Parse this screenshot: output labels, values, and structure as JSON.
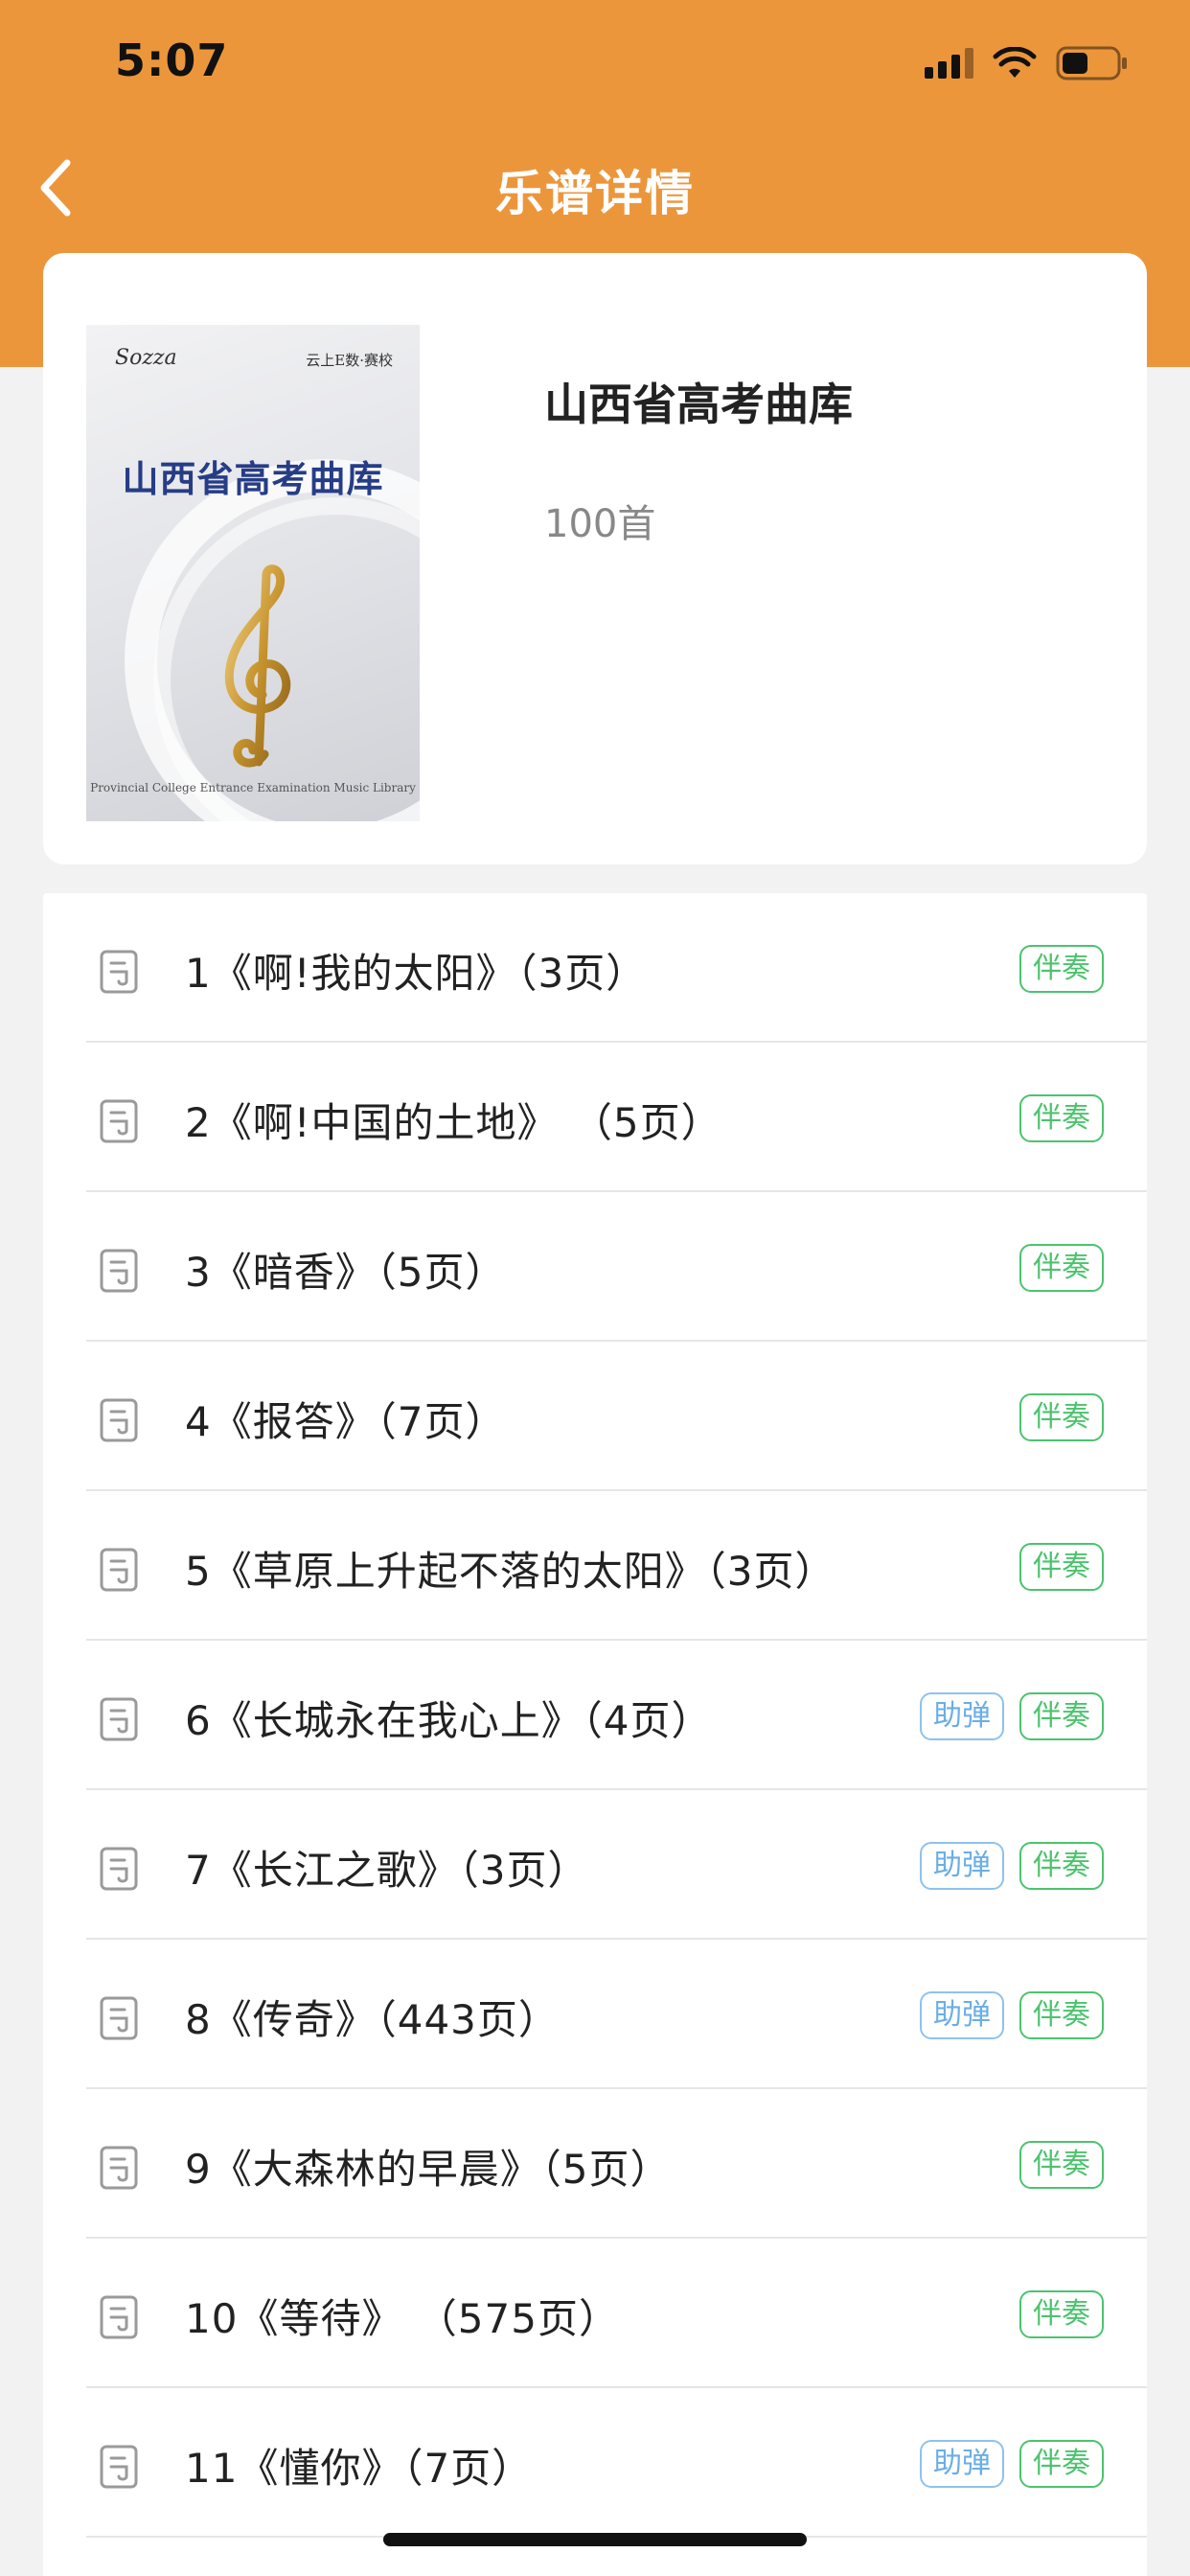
{
  "status_bar": {
    "time": "5:07"
  },
  "nav": {
    "title": "乐谱详情"
  },
  "book": {
    "title": "山西省高考曲库",
    "count": "100首",
    "cover": {
      "brand": "Sozza",
      "sub": "云上E数·赛校",
      "title": "山西省高考曲库",
      "footer": "Provincial College Entrance Examination Music Library"
    }
  },
  "songs": [
    {
      "title": "1《啊!我的太阳》（3页）",
      "tags": [
        "伴奏"
      ]
    },
    {
      "title": "2《啊!中国的土地》 （5页）",
      "tags": [
        "伴奏"
      ]
    },
    {
      "title": "3《暗香》（5页）",
      "tags": [
        "伴奏"
      ]
    },
    {
      "title": "4《报答》（7页）",
      "tags": [
        "伴奏"
      ]
    },
    {
      "title": "5《草原上升起不落的太阳》（3页）",
      "tags": [
        "伴奏"
      ]
    },
    {
      "title": "6《长城永在我心上》（4页）",
      "tags": [
        "助弹",
        "伴奏"
      ]
    },
    {
      "title": "7《长江之歌》（3页）",
      "tags": [
        "助弹",
        "伴奏"
      ]
    },
    {
      "title": "8《传奇》（443页）",
      "tags": [
        "助弹",
        "伴奏"
      ]
    },
    {
      "title": "9《大森林的早晨》（5页）",
      "tags": [
        "伴奏"
      ]
    },
    {
      "title": "10《等待》 （575页）",
      "tags": [
        "伴奏"
      ]
    },
    {
      "title": "11《懂你》（7页）",
      "tags": [
        "助弹",
        "伴奏"
      ]
    }
  ],
  "colors": {
    "header": "#ec963c",
    "tag_banzou": "#4cc36e",
    "tag_zhutan": "#6aaee6"
  },
  "icons": {
    "back": "chevron-left-icon",
    "score": "sheet-music-icon",
    "signal": "cellular-signal-icon",
    "wifi": "wifi-icon",
    "battery": "battery-icon"
  }
}
